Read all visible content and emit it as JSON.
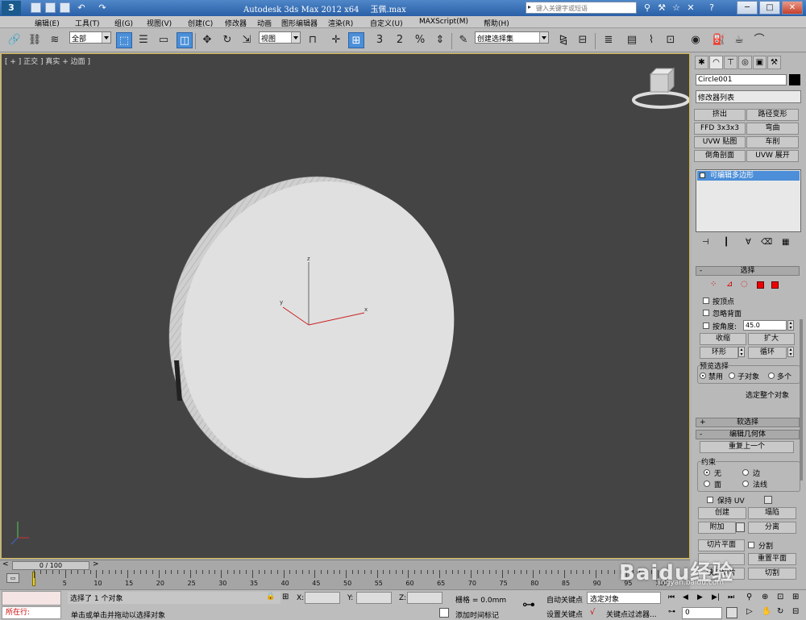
{
  "title_bar": {
    "app": "Autodesk 3ds Max  2012 x64",
    "file": "玉佩.max",
    "search_placeholder": "键入关键字或短语",
    "minimize": "─",
    "maximize": "□",
    "close": "✕"
  },
  "menu": [
    "编辑(E)",
    "工具(T)",
    "组(G)",
    "视图(V)",
    "创建(C)",
    "修改器",
    "动画",
    "图形编辑器",
    "渲染(R)",
    "自定义(U)",
    "MAXScript(M)",
    "帮助(H)"
  ],
  "toolbar": {
    "filter": "全部",
    "ref_coord": "视图",
    "snap_3": "3",
    "snap_2": "2",
    "percent_snap": "%",
    "named_selection": "创建选择集"
  },
  "viewport": {
    "label": "[ + ] 正交 ] 真实 + 边面 ]",
    "axis_x": "x",
    "axis_y": "y",
    "axis_z": "z",
    "colors": {
      "background": "#444444",
      "border": "#d4b64a",
      "disc_face": "#e0e0e0",
      "disc_edge": "#bdbdbd",
      "gizmo_x": "#cc2222"
    }
  },
  "command_panel": {
    "object_name": "Circle001",
    "modifier_list": "修改器列表",
    "buttons": [
      [
        "挤出",
        "路径变形"
      ],
      [
        "FFD 3x3x3",
        "弯曲"
      ],
      [
        "UVW 贴图",
        "车削"
      ],
      [
        "倒角剖面",
        "UVW 展开"
      ]
    ],
    "stack_item": "可编辑多边形",
    "select_rollout": "选择",
    "by_vertex": "按顶点",
    "ignore_backface": "忽略背面",
    "by_angle": "按角度:",
    "angle_value": "45.0",
    "shrink": "收缩",
    "grow": "扩大",
    "ring": "环形",
    "loop": "循环",
    "preview_title": "预览选择",
    "preview_opts": [
      "禁用",
      "子对象",
      "多个"
    ],
    "select_whole": "选定整个对象",
    "soft_sel": "软选择",
    "edit_geom": "编辑几何体",
    "repeat_last": "重复上一个",
    "constraints_title": "约束",
    "constraints": [
      "无",
      "边",
      "面",
      "法线"
    ],
    "preserve_uv": "保持 UV",
    "create": "创建",
    "collapse": "塌陷",
    "attach": "附加",
    "detach": "分离",
    "slice_plane": "切片平面",
    "split": "分割",
    "reset_plane": "重置平面",
    "quickslice": "快速切片",
    "cut": "切割"
  },
  "timeline": {
    "slider": "0 / 100",
    "ticks": [
      "0",
      "5",
      "10",
      "15",
      "20",
      "25",
      "30",
      "35",
      "40",
      "45",
      "50",
      "55",
      "60",
      "65",
      "70",
      "75",
      "80",
      "85",
      "90",
      "95",
      "100"
    ]
  },
  "status": {
    "running": "所在行:",
    "selected": "选择了 1 个对象",
    "prompt": "单击或单击并拖动以选择对象",
    "x_label": "X:",
    "y_label": "Y:",
    "z_label": "Z:",
    "grid": "栅格 = 0.0mm",
    "add_time_tag": "添加时间标记",
    "auto_key": "自动关键点",
    "set_key": "设置关键点",
    "selected_obj": "选定对象",
    "key_filters": "关键点过滤器...",
    "frame": "0"
  },
  "watermark": {
    "brand": "Baidu经验",
    "url": "jingyan.baidu.com"
  }
}
